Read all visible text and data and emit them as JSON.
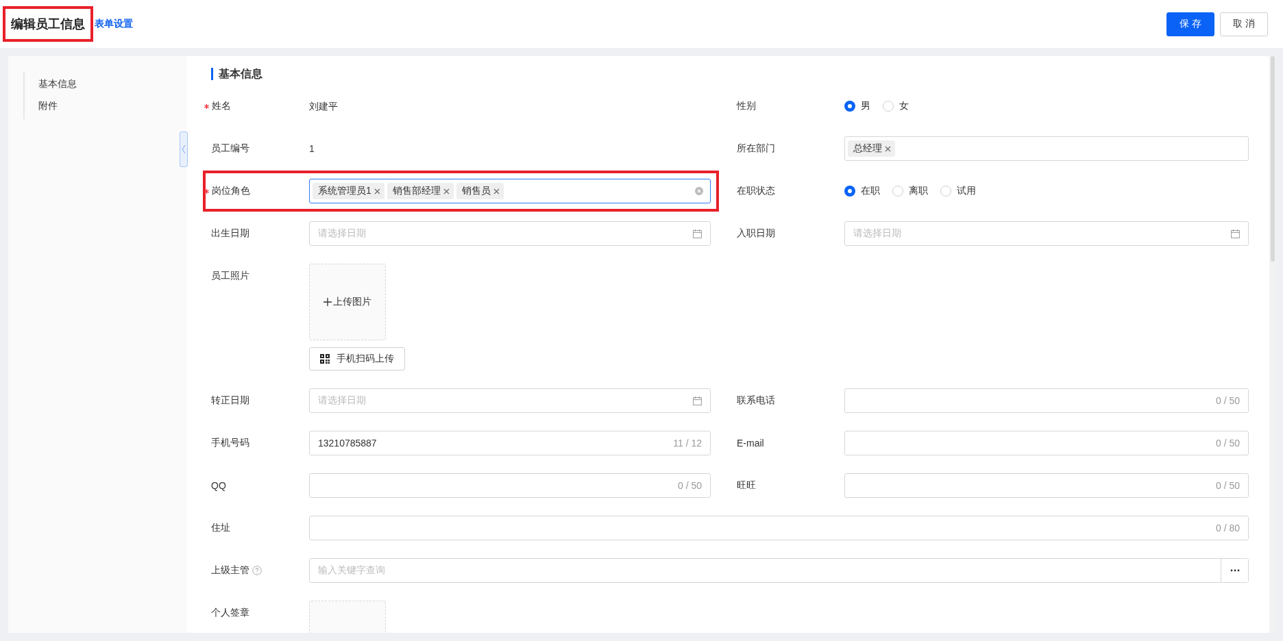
{
  "header": {
    "title": "编辑员工信息",
    "title_highlighted": true,
    "link": "表单设置",
    "buttons": [
      {
        "label": "保 存",
        "kind": "primary"
      },
      {
        "label": "取 消",
        "kind": "default"
      }
    ]
  },
  "sidebar": {
    "items": [
      {
        "label": "基本信息"
      },
      {
        "label": "附件"
      }
    ]
  },
  "section": {
    "title": "基本信息"
  },
  "rows": [
    [
      {
        "label": "姓名",
        "required": true,
        "kind": "text",
        "value": "刘建平"
      },
      {
        "label": "性别",
        "kind": "radio",
        "options": [
          {
            "label": "男",
            "selected": true
          },
          {
            "label": "女",
            "selected": false
          }
        ]
      }
    ],
    [
      {
        "label": "员工编号",
        "kind": "text",
        "value": "1"
      },
      {
        "label": "所在部门",
        "kind": "tags",
        "tags": [
          "总经理"
        ]
      }
    ],
    [
      {
        "label": "岗位角色",
        "required": true,
        "kind": "tags",
        "tags": [
          "系统管理员1",
          "销售部经理",
          "销售员"
        ],
        "focused": true,
        "clearable": true,
        "highlighted": true
      },
      {
        "label": "在职状态",
        "kind": "radio",
        "options": [
          {
            "label": "在职",
            "selected": true
          },
          {
            "label": "离职",
            "selected": false
          },
          {
            "label": "试用",
            "selected": false
          }
        ]
      }
    ],
    [
      {
        "label": "出生日期",
        "kind": "date",
        "placeholder": "请选择日期"
      },
      {
        "label": "入职日期",
        "kind": "date",
        "placeholder": "请选择日期"
      }
    ],
    [
      {
        "label": "员工照片",
        "kind": "upload",
        "upload_label": "上传图片",
        "scan_button": "手机扫码上传"
      }
    ],
    [
      {
        "label": "转正日期",
        "kind": "date",
        "placeholder": "请选择日期"
      },
      {
        "label": "联系电话",
        "kind": "counter",
        "counter": "0 / 50"
      }
    ],
    [
      {
        "label": "手机号码",
        "kind": "counter",
        "value": "13210785887",
        "counter": "11 / 12"
      },
      {
        "label": "E-mail",
        "kind": "counter",
        "counter": "0 / 50"
      }
    ],
    [
      {
        "label": "QQ",
        "kind": "counter",
        "counter": "0 / 50"
      },
      {
        "label": "旺旺",
        "kind": "counter",
        "counter": "0 / 50"
      }
    ],
    [
      {
        "label": "住址",
        "kind": "counter",
        "counter": "0 / 80"
      }
    ],
    [
      {
        "label": "上级主管",
        "help": true,
        "kind": "search",
        "placeholder": "输入关键字查询"
      }
    ],
    [
      {
        "label": "个人签章",
        "kind": "signature"
      }
    ]
  ]
}
